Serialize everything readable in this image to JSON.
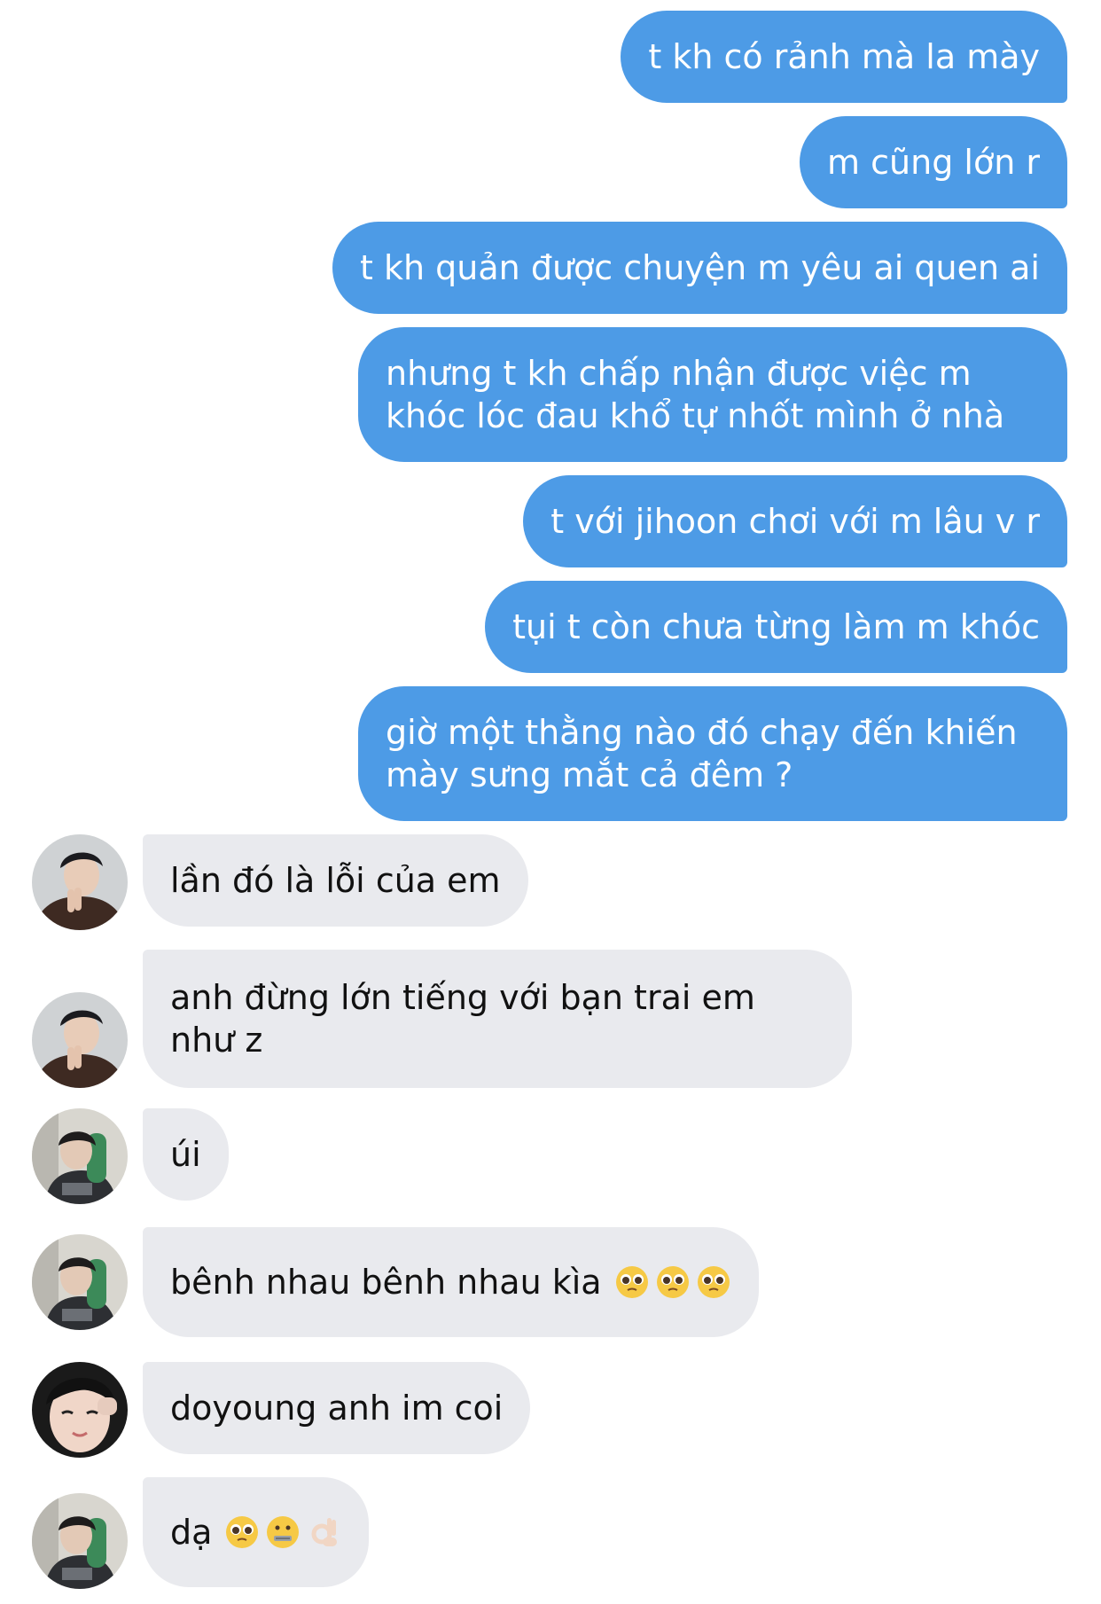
{
  "conversation": {
    "outgoing": [
      {
        "text": "t kh có rảnh mà la mày"
      },
      {
        "text": "m cũng lớn r"
      },
      {
        "text": "t kh quản được chuyện m yêu ai quen ai"
      },
      {
        "text": "nhưng t kh chấp nhận được việc m khóc lóc đau khổ tự nhốt mình ở nhà"
      },
      {
        "text": "t với jihoon chơi với m lâu v r"
      },
      {
        "text": "tụi t còn chưa từng làm m khóc"
      },
      {
        "text": "giờ một thằng nào đó chạy đến khiến mày sưng mắt cả đêm ?"
      }
    ],
    "incoming": [
      {
        "text": "lần đó là lỗi của em",
        "avatar": "avatar-brown-jacket"
      },
      {
        "text": "anh đừng lớn tiếng với bạn trai em như z",
        "avatar": "avatar-brown-jacket"
      },
      {
        "text": "úi",
        "avatar": "avatar-green-sleeve"
      },
      {
        "text": "bênh nhau bênh nhau kìa",
        "emojis": [
          "pleading-face-emoji",
          "pleading-face-emoji",
          "pleading-face-emoji"
        ],
        "avatar": "avatar-green-sleeve"
      },
      {
        "text": "doyoung anh im coi",
        "avatar": "avatar-closeup-face"
      },
      {
        "text": "dạ",
        "emojis": [
          "pleading-face-emoji",
          "zipper-mouth-face-emoji",
          "ok-hand-emoji"
        ],
        "avatar": "avatar-green-sleeve"
      }
    ]
  },
  "colors": {
    "outgoing_bubble": "#4d9be6",
    "incoming_bubble": "#e9eaee",
    "outgoing_text": "#ffffff",
    "incoming_text": "#111111"
  }
}
